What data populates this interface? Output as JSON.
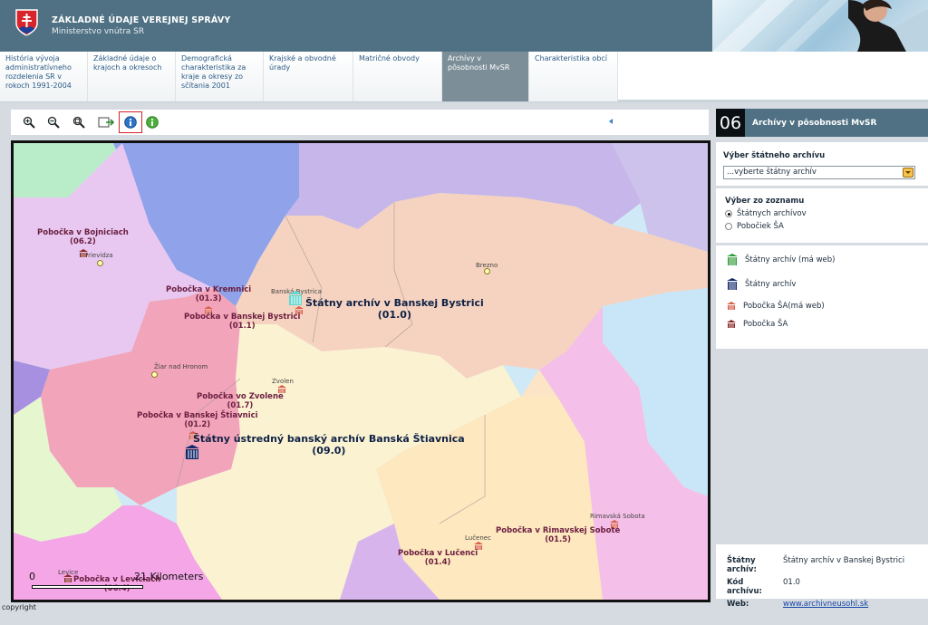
{
  "header": {
    "title": "ZÁKLADNÉ ÚDAJE VEREJNEJ SPRÁVY",
    "subtitle": "Ministerstvo vnútra SR"
  },
  "nav": {
    "tabs": [
      {
        "label": "História vývoja administratívneho rozdelenia SR v rokoch 1991-2004",
        "active": false
      },
      {
        "label": "Základné údaje o krajoch a okresoch",
        "active": false
      },
      {
        "label": "Demografická charakteristika za kraje a okresy zo sčítania 2001",
        "active": false
      },
      {
        "label": "Krajské a obvodné úrady",
        "active": false
      },
      {
        "label": "Matričné obvody",
        "active": false
      },
      {
        "label": "Archívy v pôsobnosti MvSR",
        "active": true
      },
      {
        "label": "Charakteristika obcí",
        "active": false
      }
    ]
  },
  "toolbar": {
    "tools": [
      "zoom-in-icon",
      "zoom-out-icon",
      "zoom-full-icon",
      "pan-icon",
      "info-icon",
      "identify-icon"
    ],
    "selected": "info-icon"
  },
  "map": {
    "labels": {
      "bojnice": "Pobočka v Bojniciach",
      "bojnice_code": "(06.2)",
      "kremnica": "Pobočka v Kremnici",
      "kremnica_code": "(01.3)",
      "bb_branch": "Pobočka v Banskej Bystrici",
      "bb_branch_code": "(01.1)",
      "bb_archive": "Štátny archív v Banskej Bystrici",
      "bb_archive_code": "(01.0)",
      "zvolen": "Pobočka vo Zvolene",
      "zvolen_code": "(01.7)",
      "bs_branch": "Pobočka v Banskej Štiavnici",
      "bs_branch_code": "(01.2)",
      "bs_central": "Štátny ústredný banský archív Banská Štiavnica",
      "bs_central_code": "(09.0)",
      "rimavska": "Pobočka v Rimavskej Sobote",
      "rimavska_code": "(01.5)",
      "lucenec": "Pobočka v Lučenci",
      "lucenec_code": "(01.4)",
      "levice": "Pobočka v Leviciach",
      "levice_code": "(06.4)"
    },
    "towns": {
      "prievidza": "Prievidza",
      "brezno": "Brezno",
      "banska_bystrica": "Banská Bystrica",
      "ziar": "Žiar nad Hronom",
      "zvolen": "Zvolen",
      "rimavska": "Rimavská Sobota",
      "lucenec": "Lučenec",
      "levice": "Levice"
    },
    "scalebar": {
      "start": "0",
      "end": "21 Kilometers"
    }
  },
  "copyright": "copyright",
  "right_panel": {
    "number": "06",
    "title": "Archívy v pôsobnosti MvSR",
    "select_label": "Výber štátneho archívu",
    "select_value": "...vyberte štátny archív",
    "list_label": "Výber zo zoznamu",
    "radio_options": [
      {
        "label": "Štátnych archívov",
        "checked": true
      },
      {
        "label": "Pobočiek ŠA",
        "checked": false
      }
    ],
    "legend": [
      {
        "label": "Štátny archív (má web)",
        "color": "#2f9a3a",
        "icon": "state-archive-web-icon"
      },
      {
        "label": "Štátny archív",
        "color": "#13286b",
        "icon": "state-archive-icon"
      },
      {
        "label": "Pobočka ŠA(má web)",
        "color": "#d9604b",
        "icon": "branch-web-icon"
      },
      {
        "label": "Pobočka ŠA",
        "color": "#8a2a2a",
        "icon": "branch-icon"
      }
    ],
    "info": {
      "archive_key": "Štátny archív:",
      "archive_val": "Štátny archív v Banskej Bystrici",
      "code_key": "Kód archívu:",
      "code_val": "01.0",
      "web_key": "Web:",
      "web_val": "www.archivneusohl.sk"
    }
  }
}
